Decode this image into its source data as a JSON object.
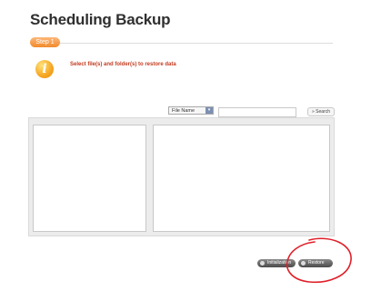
{
  "header": {
    "title": "Scheduling Backup"
  },
  "step": {
    "label": "Step 1"
  },
  "info": {
    "icon_glyph": "i",
    "instruction": "Select file(s) and folder(s) to restore data"
  },
  "filter": {
    "select_value": "File Name",
    "select_arrow_glyph": "▾",
    "search_value": "",
    "search_button_label": "» Search"
  },
  "actions": {
    "initialization_label": "Initialization",
    "restore_label": "Restore"
  },
  "colors": {
    "accent_orange": "#f08a2b",
    "instruction_red": "#c33a1f",
    "annotation_red": "#e0202a"
  }
}
